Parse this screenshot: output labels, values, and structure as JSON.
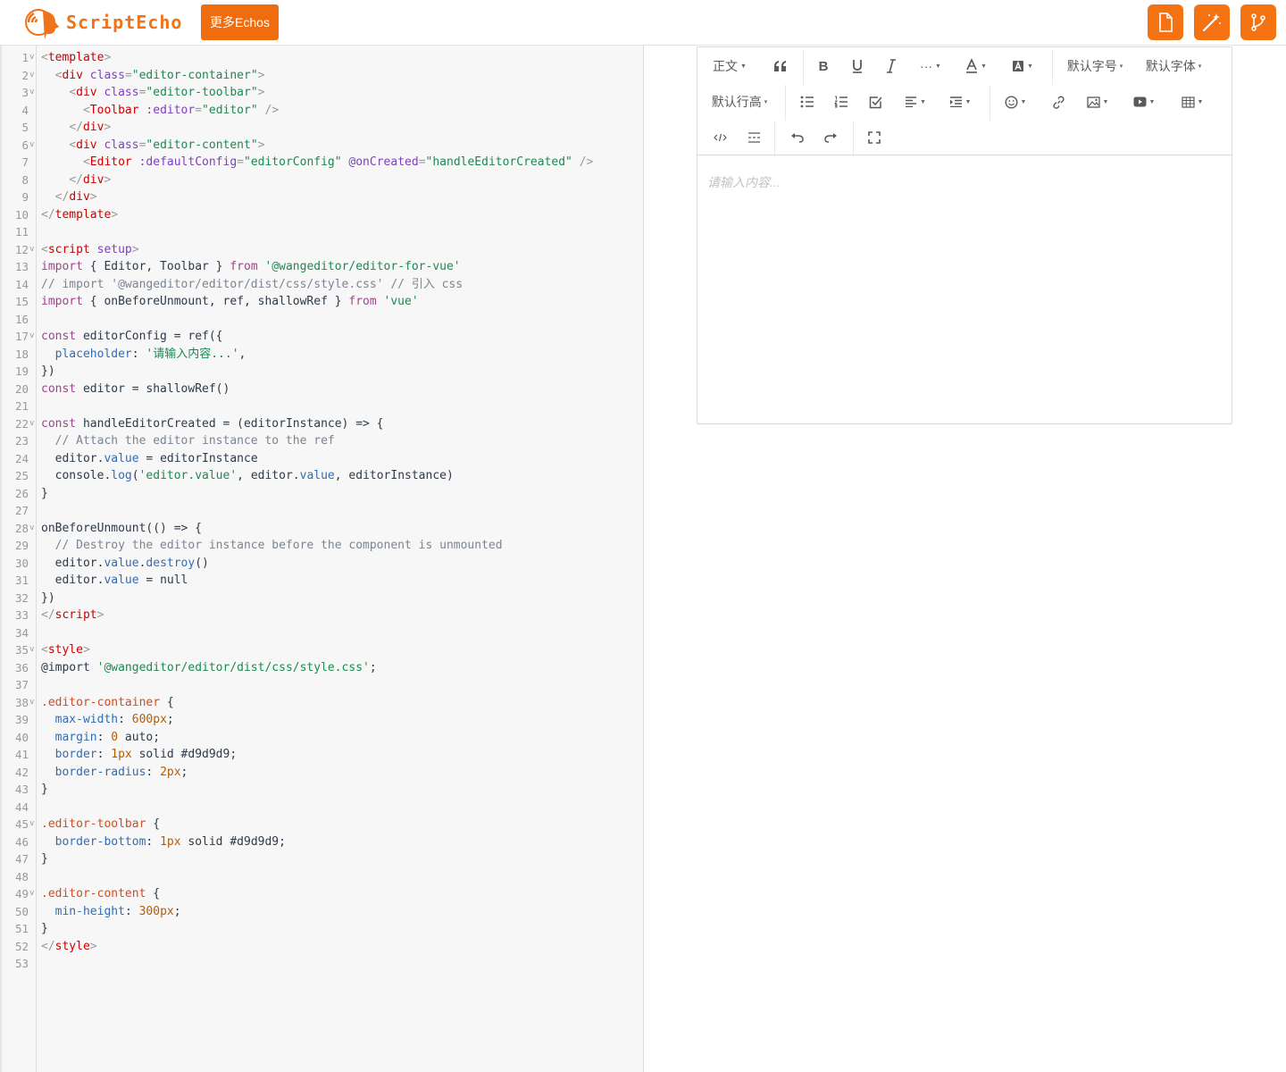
{
  "header": {
    "logo_text": "ScriptEcho",
    "more_button": "更多Echos",
    "actions": [
      {
        "icon": "file-icon"
      },
      {
        "icon": "magic-wand-icon"
      },
      {
        "icon": "branch-icon"
      }
    ]
  },
  "code_lines": [
    {
      "n": "1",
      "fold": true,
      "t": [
        [
          "br",
          "<"
        ],
        [
          "tag",
          "template"
        ],
        [
          "br",
          ">"
        ]
      ]
    },
    {
      "n": "2",
      "fold": true,
      "t": [
        [
          "txt",
          "  "
        ],
        [
          "br",
          "<"
        ],
        [
          "tag",
          "div"
        ],
        [
          "txt",
          " "
        ],
        [
          "attr",
          "class"
        ],
        [
          "br",
          "="
        ],
        [
          "str",
          "\"editor-container\""
        ],
        [
          "br",
          ">"
        ]
      ]
    },
    {
      "n": "3",
      "fold": true,
      "t": [
        [
          "txt",
          "    "
        ],
        [
          "br",
          "<"
        ],
        [
          "tag",
          "div"
        ],
        [
          "txt",
          " "
        ],
        [
          "attr",
          "class"
        ],
        [
          "br",
          "="
        ],
        [
          "str",
          "\"editor-toolbar\""
        ],
        [
          "br",
          ">"
        ]
      ]
    },
    {
      "n": "4",
      "fold": false,
      "t": [
        [
          "txt",
          "      "
        ],
        [
          "br",
          "<"
        ],
        [
          "tag",
          "Toolbar"
        ],
        [
          "txt",
          " "
        ],
        [
          "attr",
          ":editor"
        ],
        [
          "br",
          "="
        ],
        [
          "str",
          "\"editor\""
        ],
        [
          "txt",
          " "
        ],
        [
          "br",
          "/>"
        ]
      ]
    },
    {
      "n": "5",
      "fold": false,
      "t": [
        [
          "txt",
          "    "
        ],
        [
          "br",
          "</"
        ],
        [
          "tag",
          "div"
        ],
        [
          "br",
          ">"
        ]
      ]
    },
    {
      "n": "6",
      "fold": true,
      "t": [
        [
          "txt",
          "    "
        ],
        [
          "br",
          "<"
        ],
        [
          "tag",
          "div"
        ],
        [
          "txt",
          " "
        ],
        [
          "attr",
          "class"
        ],
        [
          "br",
          "="
        ],
        [
          "str",
          "\"editor-content\""
        ],
        [
          "br",
          ">"
        ]
      ]
    },
    {
      "n": "7",
      "fold": false,
      "t": [
        [
          "txt",
          "      "
        ],
        [
          "br",
          "<"
        ],
        [
          "tag",
          "Editor"
        ],
        [
          "txt",
          " "
        ],
        [
          "attr",
          ":defaultConfig"
        ],
        [
          "br",
          "="
        ],
        [
          "str",
          "\"editorConfig\""
        ],
        [
          "txt",
          " "
        ],
        [
          "attr",
          "@onCreated"
        ],
        [
          "br",
          "="
        ],
        [
          "str",
          "\"handleEditorCreated\""
        ],
        [
          "txt",
          " "
        ],
        [
          "br",
          "/>"
        ]
      ]
    },
    {
      "n": "8",
      "fold": false,
      "t": [
        [
          "txt",
          "    "
        ],
        [
          "br",
          "</"
        ],
        [
          "tag",
          "div"
        ],
        [
          "br",
          ">"
        ]
      ]
    },
    {
      "n": "9",
      "fold": false,
      "t": [
        [
          "txt",
          "  "
        ],
        [
          "br",
          "</"
        ],
        [
          "tag",
          "div"
        ],
        [
          "br",
          ">"
        ]
      ]
    },
    {
      "n": "10",
      "fold": false,
      "t": [
        [
          "br",
          "</"
        ],
        [
          "tag",
          "template"
        ],
        [
          "br",
          ">"
        ]
      ]
    },
    {
      "n": "11",
      "fold": false,
      "t": []
    },
    {
      "n": "12",
      "fold": true,
      "t": [
        [
          "br",
          "<"
        ],
        [
          "tag",
          "script"
        ],
        [
          "txt",
          " "
        ],
        [
          "attr",
          "setup"
        ],
        [
          "br",
          ">"
        ]
      ]
    },
    {
      "n": "13",
      "fold": false,
      "t": [
        [
          "kw",
          "import"
        ],
        [
          "txt",
          " { Editor, Toolbar } "
        ],
        [
          "kw",
          "from"
        ],
        [
          "txt",
          " "
        ],
        [
          "str",
          "'@wangeditor/editor-for-vue'"
        ]
      ]
    },
    {
      "n": "14",
      "fold": false,
      "t": [
        [
          "com",
          "// import '@wangeditor/editor/dist/css/style.css' // 引入 css"
        ]
      ]
    },
    {
      "n": "15",
      "fold": false,
      "t": [
        [
          "kw",
          "import"
        ],
        [
          "txt",
          " { onBeforeUnmount, ref, shallowRef } "
        ],
        [
          "kw",
          "from"
        ],
        [
          "txt",
          " "
        ],
        [
          "str",
          "'vue'"
        ]
      ]
    },
    {
      "n": "16",
      "fold": false,
      "t": []
    },
    {
      "n": "17",
      "fold": true,
      "t": [
        [
          "kw",
          "const"
        ],
        [
          "txt",
          " editorConfig = ref({"
        ]
      ]
    },
    {
      "n": "18",
      "fold": false,
      "t": [
        [
          "txt",
          "  "
        ],
        [
          "prop",
          "placeholder"
        ],
        [
          "txt",
          ": "
        ],
        [
          "str",
          "'请输入内容...'"
        ],
        [
          "txt",
          ","
        ]
      ]
    },
    {
      "n": "19",
      "fold": false,
      "t": [
        [
          "txt",
          "})"
        ]
      ]
    },
    {
      "n": "20",
      "fold": false,
      "t": [
        [
          "kw",
          "const"
        ],
        [
          "txt",
          " editor = shallowRef()"
        ]
      ]
    },
    {
      "n": "21",
      "fold": false,
      "t": []
    },
    {
      "n": "22",
      "fold": true,
      "t": [
        [
          "kw",
          "const"
        ],
        [
          "txt",
          " handleEditorCreated = (editorInstance) => {"
        ]
      ]
    },
    {
      "n": "23",
      "fold": false,
      "t": [
        [
          "txt",
          "  "
        ],
        [
          "com",
          "// Attach the editor instance to the ref"
        ]
      ]
    },
    {
      "n": "24",
      "fold": false,
      "t": [
        [
          "txt",
          "  editor."
        ],
        [
          "prop",
          "value"
        ],
        [
          "txt",
          " = editorInstance"
        ]
      ]
    },
    {
      "n": "25",
      "fold": false,
      "t": [
        [
          "txt",
          "  console."
        ],
        [
          "prop",
          "log"
        ],
        [
          "txt",
          "("
        ],
        [
          "str",
          "'editor.value'"
        ],
        [
          "txt",
          ", editor."
        ],
        [
          "prop",
          "value"
        ],
        [
          "txt",
          ", editorInstance)"
        ]
      ]
    },
    {
      "n": "26",
      "fold": false,
      "t": [
        [
          "txt",
          "}"
        ]
      ]
    },
    {
      "n": "27",
      "fold": false,
      "t": []
    },
    {
      "n": "28",
      "fold": true,
      "t": [
        [
          "txt",
          "onBeforeUnmount(() => {"
        ]
      ]
    },
    {
      "n": "29",
      "fold": false,
      "t": [
        [
          "txt",
          "  "
        ],
        [
          "com",
          "// Destroy the editor instance before the component is unmounted"
        ]
      ]
    },
    {
      "n": "30",
      "fold": false,
      "t": [
        [
          "txt",
          "  editor."
        ],
        [
          "prop",
          "value"
        ],
        [
          "txt",
          "."
        ],
        [
          "prop",
          "destroy"
        ],
        [
          "txt",
          "()"
        ]
      ]
    },
    {
      "n": "31",
      "fold": false,
      "t": [
        [
          "txt",
          "  editor."
        ],
        [
          "prop",
          "value"
        ],
        [
          "txt",
          " = null"
        ]
      ]
    },
    {
      "n": "32",
      "fold": false,
      "t": [
        [
          "txt",
          "})"
        ]
      ]
    },
    {
      "n": "33",
      "fold": false,
      "t": [
        [
          "br",
          "</"
        ],
        [
          "tag",
          "script"
        ],
        [
          "br",
          ">"
        ]
      ]
    },
    {
      "n": "34",
      "fold": false,
      "t": []
    },
    {
      "n": "35",
      "fold": true,
      "t": [
        [
          "br",
          "<"
        ],
        [
          "tag",
          "style"
        ],
        [
          "br",
          ">"
        ]
      ]
    },
    {
      "n": "36",
      "fold": false,
      "t": [
        [
          "txt",
          "@import "
        ],
        [
          "str",
          "'@wangeditor/editor/dist/css/style.css'"
        ],
        [
          "txt",
          ";"
        ]
      ]
    },
    {
      "n": "37",
      "fold": false,
      "t": []
    },
    {
      "n": "38",
      "fold": true,
      "t": [
        [
          "sel",
          ".editor-container"
        ],
        [
          "txt",
          " {"
        ]
      ]
    },
    {
      "n": "39",
      "fold": false,
      "t": [
        [
          "txt",
          "  "
        ],
        [
          "prop",
          "max-width"
        ],
        [
          "txt",
          ": "
        ],
        [
          "num",
          "600px"
        ],
        [
          "txt",
          ";"
        ]
      ]
    },
    {
      "n": "40",
      "fold": false,
      "t": [
        [
          "txt",
          "  "
        ],
        [
          "prop",
          "margin"
        ],
        [
          "txt",
          ": "
        ],
        [
          "num",
          "0"
        ],
        [
          "txt",
          " auto;"
        ]
      ]
    },
    {
      "n": "41",
      "fold": false,
      "t": [
        [
          "txt",
          "  "
        ],
        [
          "prop",
          "border"
        ],
        [
          "txt",
          ": "
        ],
        [
          "num",
          "1px"
        ],
        [
          "txt",
          " solid #d9d9d9;"
        ]
      ]
    },
    {
      "n": "42",
      "fold": false,
      "t": [
        [
          "txt",
          "  "
        ],
        [
          "prop",
          "border-radius"
        ],
        [
          "txt",
          ": "
        ],
        [
          "num",
          "2px"
        ],
        [
          "txt",
          ";"
        ]
      ]
    },
    {
      "n": "43",
      "fold": false,
      "t": [
        [
          "txt",
          "}"
        ]
      ]
    },
    {
      "n": "44",
      "fold": false,
      "t": []
    },
    {
      "n": "45",
      "fold": true,
      "t": [
        [
          "sel",
          ".editor-toolbar"
        ],
        [
          "txt",
          " {"
        ]
      ]
    },
    {
      "n": "46",
      "fold": false,
      "t": [
        [
          "txt",
          "  "
        ],
        [
          "prop",
          "border-bottom"
        ],
        [
          "txt",
          ": "
        ],
        [
          "num",
          "1px"
        ],
        [
          "txt",
          " solid #d9d9d9;"
        ]
      ]
    },
    {
      "n": "47",
      "fold": false,
      "t": [
        [
          "txt",
          "}"
        ]
      ]
    },
    {
      "n": "48",
      "fold": false,
      "t": []
    },
    {
      "n": "49",
      "fold": true,
      "t": [
        [
          "sel",
          ".editor-content"
        ],
        [
          "txt",
          " {"
        ]
      ]
    },
    {
      "n": "50",
      "fold": false,
      "t": [
        [
          "txt",
          "  "
        ],
        [
          "prop",
          "min-height"
        ],
        [
          "txt",
          ": "
        ],
        [
          "num",
          "300px"
        ],
        [
          "txt",
          ";"
        ]
      ]
    },
    {
      "n": "51",
      "fold": false,
      "t": [
        [
          "txt",
          "}"
        ]
      ]
    },
    {
      "n": "52",
      "fold": false,
      "t": [
        [
          "br",
          "</"
        ],
        [
          "tag",
          "style"
        ],
        [
          "br",
          ">"
        ]
      ]
    },
    {
      "n": "53",
      "fold": false,
      "t": []
    }
  ],
  "preview": {
    "toolbar": {
      "heading_select": "正文",
      "font_size_select": "默认字号",
      "font_family_select": "默认字体",
      "line_height_select": "默认行高",
      "more_glyph": "···"
    },
    "placeholder": "请输入内容..."
  }
}
